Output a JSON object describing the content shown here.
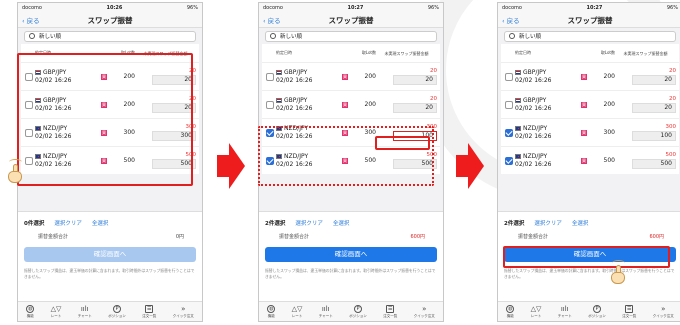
{
  "app": {
    "back_label": "戻る",
    "title": "スワップ振替",
    "carrier": "docomo",
    "battery": "96%",
    "sort_label": "新しい順",
    "headers": {
      "product": "約定日時",
      "lots": "取Lot数",
      "swap": "未実現スワップ振替金額"
    },
    "select_clear": "選択クリア",
    "select_all": "全選択",
    "total_label": "振替金額合計",
    "confirm_label": "確認画面へ",
    "notice": "振替したスワップ損益は、建玉単価の計算に含まれます。取引時間外はスワップ振替を行うことはできません。",
    "tabs": [
      {
        "label": "機能",
        "icon": "globe-icon",
        "glyph": "◍"
      },
      {
        "label": "レート",
        "icon": "rate-icon",
        "glyph": "△▽"
      },
      {
        "label": "チャート",
        "icon": "chart-icon",
        "glyph": "ıılı"
      },
      {
        "label": "ポジション",
        "icon": "position-icon",
        "glyph": "P"
      },
      {
        "label": "注文一覧",
        "icon": "order-list-icon",
        "glyph": "☰"
      },
      {
        "label": "クイック注文",
        "icon": "quick-order-icon",
        "glyph": "»"
      }
    ]
  },
  "screens": [
    {
      "time": "10:26",
      "selected_count": "0件選択",
      "total": "0円",
      "confirm_enabled": false,
      "rows": [
        {
          "pair": "GBP/JPY",
          "date": "02/02 16:26",
          "flag": "gb",
          "side": "買",
          "lots": "200",
          "swap": "20",
          "input": "20",
          "checked": false
        },
        {
          "pair": "GBP/JPY",
          "date": "02/02 16:26",
          "flag": "gb",
          "side": "買",
          "lots": "200",
          "swap": "20",
          "input": "20",
          "checked": false
        },
        {
          "pair": "NZD/JPY",
          "date": "02/02 16:26",
          "flag": "nz",
          "side": "買",
          "lots": "300",
          "swap": "300",
          "input": "300",
          "checked": false
        },
        {
          "pair": "NZD/JPY",
          "date": "02/02 16:26",
          "flag": "nz",
          "side": "買",
          "lots": "500",
          "swap": "500",
          "input": "500",
          "checked": false
        }
      ]
    },
    {
      "time": "10:27",
      "selected_count": "2件選択",
      "total": "600円",
      "confirm_enabled": true,
      "rows": [
        {
          "pair": "GBP/JPY",
          "date": "02/02 16:26",
          "flag": "gb",
          "side": "買",
          "lots": "200",
          "swap": "20",
          "input": "20",
          "checked": false
        },
        {
          "pair": "GBP/JPY",
          "date": "02/02 16:26",
          "flag": "gb",
          "side": "買",
          "lots": "200",
          "swap": "20",
          "input": "20",
          "checked": false
        },
        {
          "pair": "NZD/JPY",
          "date": "02/02 16:26",
          "flag": "nz",
          "side": "買",
          "lots": "300",
          "swap": "300",
          "input": "100",
          "checked": true
        },
        {
          "pair": "NZD/JPY",
          "date": "02/02 16:26",
          "flag": "nz",
          "side": "買",
          "lots": "500",
          "swap": "500",
          "input": "500",
          "checked": true
        }
      ]
    },
    {
      "time": "10:27",
      "selected_count": "2件選択",
      "total": "600円",
      "confirm_enabled": true,
      "rows": [
        {
          "pair": "GBP/JPY",
          "date": "02/02 16:26",
          "flag": "gb",
          "side": "買",
          "lots": "200",
          "swap": "20",
          "input": "20",
          "checked": false
        },
        {
          "pair": "GBP/JPY",
          "date": "02/02 16:26",
          "flag": "gb",
          "side": "買",
          "lots": "200",
          "swap": "20",
          "input": "20",
          "checked": false
        },
        {
          "pair": "NZD/JPY",
          "date": "02/02 16:26",
          "flag": "nz",
          "side": "買",
          "lots": "300",
          "swap": "300",
          "input": "100",
          "checked": true
        },
        {
          "pair": "NZD/JPY",
          "date": "02/02 16:26",
          "flag": "nz",
          "side": "買",
          "lots": "500",
          "swap": "500",
          "input": "500",
          "checked": true
        }
      ]
    }
  ]
}
